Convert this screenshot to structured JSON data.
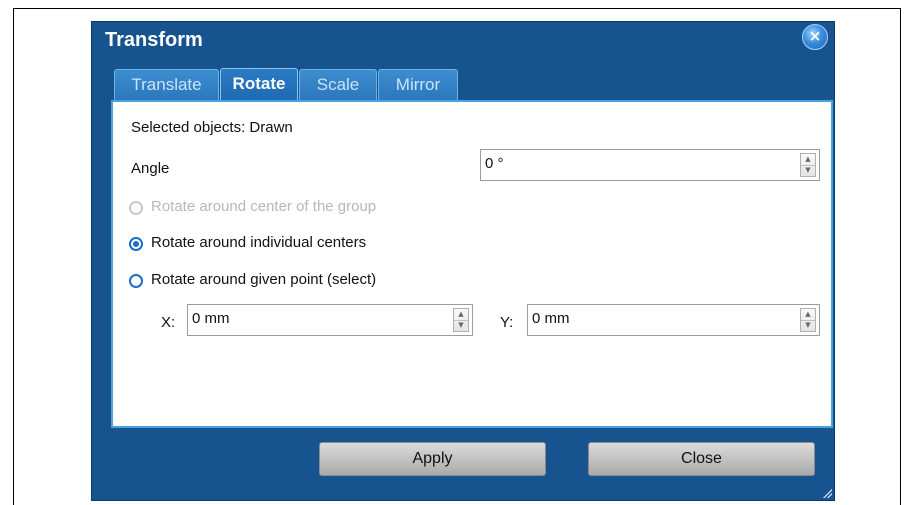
{
  "window": {
    "title": "Transform",
    "close_glyph": "×"
  },
  "tabs": [
    {
      "label": "Translate",
      "active": false
    },
    {
      "label": "Rotate",
      "active": true
    },
    {
      "label": "Scale",
      "active": false
    },
    {
      "label": "Mirror",
      "active": false
    }
  ],
  "panel": {
    "selected_objects": "Selected objects: Drawn",
    "angle_label": "Angle",
    "angle_value": "0 °",
    "options": [
      {
        "label": "Rotate around center of the group",
        "checked": false,
        "enabled": false
      },
      {
        "label": "Rotate around individual centers",
        "checked": true,
        "enabled": true
      },
      {
        "label": "Rotate around given point (select)",
        "checked": false,
        "enabled": true
      }
    ],
    "x_label": "X:",
    "x_value": "0 mm",
    "y_label": "Y:",
    "y_value": "0 mm"
  },
  "buttons": {
    "apply": "Apply",
    "close": "Close"
  },
  "spin_glyphs": {
    "up": "▲",
    "down": "▼"
  },
  "colors": {
    "window": "#17538f",
    "tab": "#2c77bd",
    "panel_border": "#4aa3e0",
    "radio": "#1c6fc1"
  }
}
